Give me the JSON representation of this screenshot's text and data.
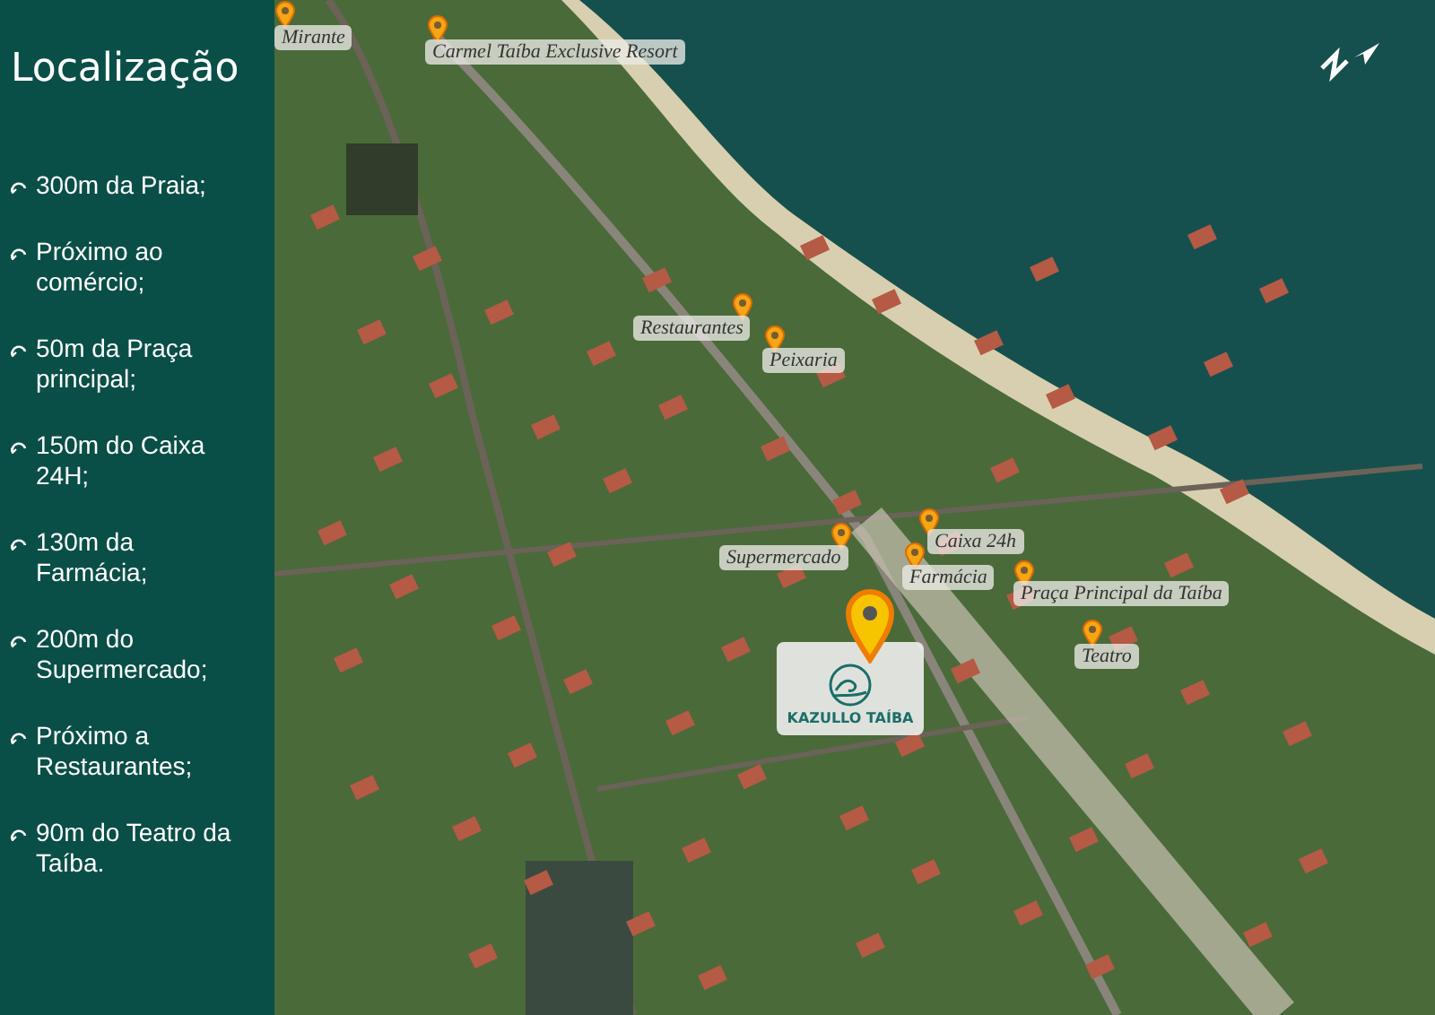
{
  "sidebar": {
    "title": "Localização",
    "items": [
      {
        "text": "300m da Praia;"
      },
      {
        "text": "Próximo ao comércio;"
      },
      {
        "text": "50m da Praça principal;"
      },
      {
        "text": "150m do Caixa 24H;"
      },
      {
        "text": "130m da Farmácia;"
      },
      {
        "text": "200m do Supermercado;"
      },
      {
        "text": "Próximo a Restaurantes;"
      },
      {
        "text": "90m do Teatro da Taíba."
      }
    ]
  },
  "map": {
    "pins": [
      {
        "label": "Mirante"
      },
      {
        "label": "Carmel Taíba Exclusive Resort"
      },
      {
        "label": "Restaurantes"
      },
      {
        "label": "Peixaria"
      },
      {
        "label": "Supermercado"
      },
      {
        "label": "Caixa 24h"
      },
      {
        "label": "Farmácia"
      },
      {
        "label": "Praça Principal da Taíba"
      },
      {
        "label": "Teatro"
      }
    ],
    "main_marker": {
      "logo_text": "KAZULLO TAÍBA"
    }
  }
}
